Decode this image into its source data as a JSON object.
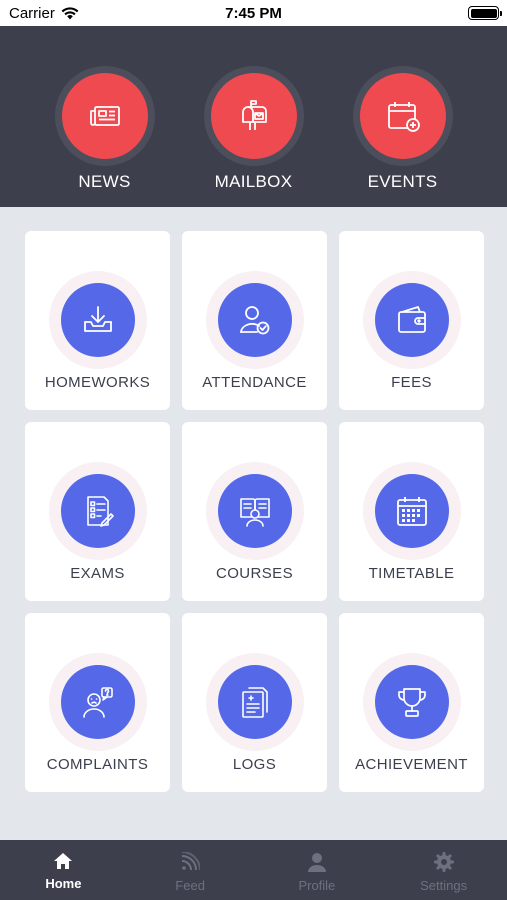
{
  "status_bar": {
    "carrier": "Carrier",
    "time": "7:45 PM"
  },
  "top_panel": {
    "items": [
      {
        "label": "NEWS",
        "icon": "newspaper-icon"
      },
      {
        "label": "MAILBOX",
        "icon": "mailbox-icon"
      },
      {
        "label": "EVENTS",
        "icon": "calendar-plus-icon"
      }
    ],
    "accent": "#ef4a4f"
  },
  "grid": {
    "accent": "#5468e8",
    "items": [
      {
        "label": "HOMEWORKS",
        "icon": "download-tray-icon"
      },
      {
        "label": "ATTENDANCE",
        "icon": "user-check-icon"
      },
      {
        "label": "FEES",
        "icon": "wallet-icon"
      },
      {
        "label": "EXAMS",
        "icon": "exam-sheet-icon"
      },
      {
        "label": "COURSES",
        "icon": "book-reader-icon"
      },
      {
        "label": "TIMETABLE",
        "icon": "calendar-grid-icon"
      },
      {
        "label": "COMPLAINTS",
        "icon": "user-question-icon"
      },
      {
        "label": "LOGS",
        "icon": "documents-icon"
      },
      {
        "label": "ACHIEVEMENT",
        "icon": "trophy-icon"
      }
    ]
  },
  "tab_bar": {
    "active": "Home",
    "tabs": [
      {
        "label": "Home",
        "icon": "home-icon"
      },
      {
        "label": "Feed",
        "icon": "rss-icon"
      },
      {
        "label": "Profile",
        "icon": "person-icon"
      },
      {
        "label": "Settings",
        "icon": "gear-icon"
      }
    ]
  }
}
